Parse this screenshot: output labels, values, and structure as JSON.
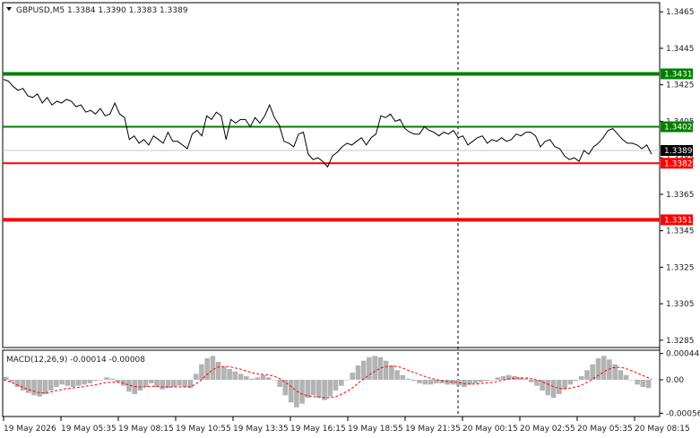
{
  "header": {
    "symbol": "GBPUSD,M5",
    "ohlc": "1.3384 1.3390 1.3383 1.3389"
  },
  "macd_header": {
    "label": "MACD(12,26,9) -0.00014 -0.00008"
  },
  "colors": {
    "background": "#ffffff",
    "price_line": "#000000",
    "support_resistance_green": "#008000",
    "support_resistance_red": "#ff0000",
    "macd_hist": "#b3b3b3",
    "macd_signal": "#ff0000"
  },
  "chart_data": {
    "type": "line",
    "price_axis": {
      "ticks": [
        "1.3465",
        "1.3445",
        "1.3425",
        "1.3405",
        "1.3385",
        "1.3365",
        "1.3345",
        "1.3325",
        "1.3305",
        "1.3285"
      ],
      "ylim": [
        1.3281,
        1.347
      ]
    },
    "levels": [
      {
        "value": 1.3431,
        "label": "1.3431",
        "color": "#008000",
        "width": 4
      },
      {
        "value": 1.3402,
        "label": "1.3402",
        "color": "#008000",
        "width": 2
      },
      {
        "value": 1.3382,
        "label": "1.3382",
        "color": "#ff0000",
        "width": 2
      },
      {
        "value": 1.3351,
        "label": "1.3351",
        "color": "#ff0000",
        "width": 4
      }
    ],
    "current_price": {
      "value": 1.3389,
      "label": "1.3389"
    },
    "time_axis": {
      "ticks": [
        "19 May 2026",
        "19 May 05:35",
        "19 May 08:15",
        "19 May 10:55",
        "19 May 13:35",
        "19 May 16:15",
        "19 May 18:55",
        "19 May 21:35",
        "20 May 00:15",
        "20 May 02:55",
        "20 May 05:35",
        "20 May 08:15"
      ]
    },
    "price_series": [
      1.3428,
      1.3427,
      1.3424,
      1.3422,
      1.3423,
      1.3419,
      1.3418,
      1.342,
      1.3415,
      1.3418,
      1.3414,
      1.3416,
      1.3415,
      1.3417,
      1.3416,
      1.3413,
      1.3414,
      1.341,
      1.3411,
      1.3409,
      1.3412,
      1.3408,
      1.3409,
      1.3415,
      1.3409,
      1.3407,
      1.3395,
      1.3397,
      1.3393,
      1.3395,
      1.3392,
      1.3397,
      1.3395,
      1.3393,
      1.3399,
      1.3394,
      1.3394,
      1.3392,
      1.339,
      1.3398,
      1.34,
      1.3397,
      1.3408,
      1.3406,
      1.341,
      1.3408,
      1.3395,
      1.3406,
      1.3404,
      1.3406,
      1.3406,
      1.3402,
      1.3407,
      1.3404,
      1.3408,
      1.3414,
      1.3407,
      1.3403,
      1.3394,
      1.3393,
      1.3391,
      1.3398,
      1.3399,
      1.3387,
      1.3384,
      1.3385,
      1.3383,
      1.338,
      1.3386,
      1.3388,
      1.3391,
      1.3393,
      1.3392,
      1.3394,
      1.3396,
      1.3392,
      1.3396,
      1.3398,
      1.3408,
      1.3407,
      1.3409,
      1.3405,
      1.3406,
      1.3401,
      1.3399,
      1.3398,
      1.3398,
      1.3402,
      1.34,
      1.3399,
      1.3397,
      1.3399,
      1.3398,
      1.34,
      1.3396,
      1.3397,
      1.3392,
      1.3394,
      1.3396,
      1.3397,
      1.3393,
      1.3395,
      1.3394,
      1.3396,
      1.3394,
      1.3395,
      1.3398,
      1.3397,
      1.3399,
      1.3399,
      1.3397,
      1.3391,
      1.3394,
      1.3395,
      1.3391,
      1.339,
      1.3386,
      1.3384,
      1.3385,
      1.3383,
      1.3389,
      1.3387,
      1.3391,
      1.3393,
      1.3396,
      1.34,
      1.3401,
      1.3398,
      1.3395,
      1.3393,
      1.3393,
      1.3392,
      1.339,
      1.3392,
      1.3387
    ],
    "macd": {
      "ticks": [
        "0.00044",
        "0.00",
        "-0.00056"
      ],
      "ylim": [
        -0.0006,
        0.00048
      ],
      "histogram": [
        5e-05,
        -4e-05,
        -0.00012,
        -0.00018,
        -0.00022,
        -0.00026,
        -0.00028,
        -0.00024,
        -0.00018,
        -0.00012,
        -8e-05,
        -0.0001,
        -0.00012,
        -0.0001,
        -8e-05,
        -6e-05,
        -2e-05,
        0.0,
        4e-05,
        2e-05,
        -4e-05,
        -0.0001,
        -0.0002,
        -0.00024,
        -0.00018,
        -0.00012,
        -6e-05,
        -0.00012,
        -0.00016,
        -0.00014,
        -0.00012,
        -0.0001,
        -0.00012,
        -0.00014,
        0.0001,
        0.00026,
        0.00036,
        0.0004,
        0.0003,
        0.00022,
        0.00018,
        0.00014,
        0.0001,
        6e-05,
        2e-05,
        4e-05,
        8e-05,
        4e-05,
        0.0,
        -0.00012,
        -0.00026,
        -0.00038,
        -0.00046,
        -0.0004,
        -0.0003,
        -0.00026,
        -0.0003,
        -0.00034,
        -0.00028,
        -0.00018,
        -0.0001,
        0.0,
        0.00012,
        0.00024,
        0.00032,
        0.00038,
        0.0004,
        0.00038,
        0.00032,
        0.00024,
        0.00016,
        8e-05,
        2e-05,
        -2e-05,
        -6e-05,
        -8e-05,
        -8e-05,
        -6e-05,
        -6e-05,
        -8e-05,
        -8e-05,
        -0.0001,
        -0.00012,
        -8e-05,
        -6e-05,
        -4e-05,
        -2e-05,
        0.0,
        4e-05,
        6e-05,
        8e-05,
        6e-05,
        4e-05,
        2e-05,
        -4e-05,
        -0.0001,
        -0.00018,
        -0.00026,
        -0.0003,
        -0.00024,
        -0.00016,
        -8e-05,
        -2e-05,
        6e-05,
        0.00016,
        0.00026,
        0.00036,
        0.0004,
        0.00034,
        0.00026,
        0.00016,
        8e-05,
        0.0,
        -8e-05,
        -0.00012,
        -0.00014
      ],
      "signal": [
        0.0,
        -3e-05,
        -7e-05,
        -0.00011,
        -0.00015,
        -0.00018,
        -0.00021,
        -0.00022,
        -0.00021,
        -0.00019,
        -0.00017,
        -0.00015,
        -0.00014,
        -0.00013,
        -0.00012,
        -0.0001,
        -9e-05,
        -7e-05,
        -5e-05,
        -4e-05,
        -4e-05,
        -5e-05,
        -8e-05,
        -0.00011,
        -0.00012,
        -0.00012,
        -0.00011,
        -0.00011,
        -0.00012,
        -0.00012,
        -0.00012,
        -0.00012,
        -0.00012,
        -0.00012,
        -8e-05,
        -1e-05,
        8e-05,
        0.00016,
        0.00021,
        0.00022,
        0.00022,
        0.0002,
        0.00018,
        0.00015,
        0.00012,
        0.0001,
        9e-05,
        8e-05,
        6e-05,
        2e-05,
        -4e-05,
        -0.00011,
        -0.00019,
        -0.00024,
        -0.00027,
        -0.00028,
        -0.00029,
        -0.0003,
        -0.0003,
        -0.00028,
        -0.00024,
        -0.00019,
        -0.00013,
        -5e-05,
        2e-05,
        9e-05,
        0.00015,
        0.0002,
        0.00022,
        0.00023,
        0.00022,
        0.00019,
        0.00015,
        0.00012,
        8e-05,
        5e-05,
        2e-05,
        0.0,
        -2e-05,
        -3e-05,
        -4e-05,
        -5e-05,
        -7e-05,
        -7e-05,
        -7e-05,
        -6e-05,
        -5e-05,
        -4e-05,
        -2e-05,
        0.0,
        2e-05,
        3e-05,
        3e-05,
        3e-05,
        1e-05,
        -1e-05,
        -5e-05,
        -9e-05,
        -0.00013,
        -0.00015,
        -0.00015,
        -0.00013,
        -0.00011,
        -7e-05,
        -2e-05,
        4e-05,
        0.0001,
        0.00016,
        0.0002,
        0.00021,
        0.0002,
        0.00017,
        0.00013,
        9e-05,
        5e-05,
        1e-05
      ]
    }
  }
}
